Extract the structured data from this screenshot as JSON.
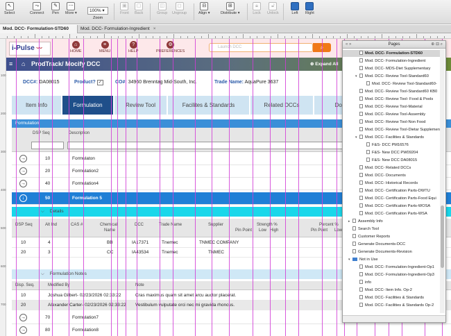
{
  "toolbar": {
    "select": "Select",
    "connect": "Connect",
    "pen": "Pen",
    "more": "More ▾",
    "zoom_value": "100%",
    "zoom_label": "Zoom",
    "front": "Front",
    "back": "Back",
    "group": "Group",
    "ungroup": "Ungroup",
    "align": "Align ▾",
    "distribute": "Distribute ▾",
    "lock": "Lock",
    "unlock": "Unlock",
    "left": "Left",
    "right": "Right"
  },
  "doc_tabs": [
    "Mod. DCC- Formulation-STD60",
    "Mod. DCC- Formulation-Ingredient"
  ],
  "header": {
    "logo": "i-Pulse",
    "nav": [
      "HOME",
      "MENU",
      "HELP",
      "PREFERENCES"
    ],
    "search_placeholder": "Launch DCC",
    "breadcrumb": "ProdTrack/ Mocify DCC",
    "expand_all": "Expand All"
  },
  "info": {
    "dcc_label": "DCC#:",
    "dcc_value": "DA08015",
    "product_label": "Product?",
    "product_mark": "✓",
    "co_label": "CO#:",
    "co_value": "34960 Brenntag Mid-South, Inc.",
    "trade_label": "Trade Name:",
    "trade_value": "AquaPure 3637"
  },
  "form_tabs": [
    "Item Info",
    "Formulation",
    "Review Tool",
    "Facilites & Standards",
    "Related DCCs",
    "Docu"
  ],
  "formulation": {
    "section": "Formulation",
    "col_dsp": "DSP Seq",
    "col_desc": "Description",
    "rows": [
      {
        "seq": "10",
        "desc": "Formulaton"
      },
      {
        "seq": "20",
        "desc": "Formulation2"
      },
      {
        "seq": "40",
        "desc": "Formulation4"
      },
      {
        "seq": "50",
        "desc": "Formulation 5"
      }
    ],
    "details_label": "Details",
    "details_cols": {
      "dsp": "DSP Seq",
      "alt": "Alt Ind",
      "cas": "CAS #",
      "chem_1": "Chemical",
      "chem_2": "Name",
      "dcc": "DCC",
      "trade": "Trade Name",
      "supplier": "Supplier",
      "strength": "Strength %",
      "pp1": "Pin Point",
      "low1": "Low",
      "high1": "High",
      "percent": "Percent %",
      "pp2": "Pin Point",
      "low2": "Low"
    },
    "details_rows": [
      {
        "dsp": "10",
        "alt": "4",
        "chem": "BB",
        "dcc": "IA17371",
        "trade": "Tnemec",
        "supplier": "TNMEC COMPANY"
      },
      {
        "dsp": "20",
        "alt": "3",
        "chem": "CC",
        "dcc": "IA43534",
        "trade": "Tnemec",
        "supplier": "TNMEC"
      }
    ],
    "notes_label": "Formulation Notes",
    "notes_cols": {
      "seq": "Disp. Seq.",
      "by": "Modified By",
      "note": "Note"
    },
    "notes_rows": [
      {
        "seq": "10",
        "by": "Joshua Gilbert- 02/23/2026  02:33:22",
        "note": "Cras maximus quam sit amet arcu auctor placerat."
      },
      {
        "seq": "20",
        "by": "Alexander Carter- 02/23/2026  02:33:22",
        "note": "Vestibulum vulputate orci nec mi gravida rhoncus."
      }
    ],
    "tail_rows": [
      {
        "seq": "70",
        "desc": "Formulation7"
      },
      {
        "seq": "80",
        "desc": "Formulation8"
      }
    ]
  },
  "ruler_v": [
    "100",
    "200",
    "300",
    "400",
    "500",
    "600",
    "700"
  ],
  "pages_panel": {
    "title": "Pages",
    "left_ctl": "«  »",
    "right_ctl": "⊕ ⊟ ⌕",
    "items": [
      {
        "t": "Mod. DCC- Formulation-STD60",
        "lvl": 1,
        "sel": true
      },
      {
        "t": "Mod. DCC- Formulation-Ingredient",
        "lvl": 1
      },
      {
        "t": "Mod. DCC- MDS-Diet Supplementary",
        "lvl": 1
      },
      {
        "t": "Mod. DCC- Review Tool-Standard60",
        "lvl": 1,
        "fold": "▾"
      },
      {
        "t": "Mod. DCC- Review Tool-Standard60-",
        "lvl": 2
      },
      {
        "t": "Mod. DCC- Review Tool-Standard60 KB0",
        "lvl": 1
      },
      {
        "t": "Mod. DCC- Review Tool- Food & Pools",
        "lvl": 1
      },
      {
        "t": "Mod. DCC- Review Tool-Material",
        "lvl": 1
      },
      {
        "t": "Mod. DCC- Review Tool-Assembly",
        "lvl": 1
      },
      {
        "t": "Mod. DCC- Review Tool-Non Food",
        "lvl": 1
      },
      {
        "t": "Mod. DCC- Review Tool-Dietar Supplement",
        "lvl": 1
      },
      {
        "t": "Mod. DCC- Facilities & Standards",
        "lvl": 1,
        "fold": "▾"
      },
      {
        "t": "F&S- DCC PM16576",
        "lvl": 2
      },
      {
        "t": "F&S- New DCC PW09204",
        "lvl": 2
      },
      {
        "t": "F&S- New DCC DA08015",
        "lvl": 2
      },
      {
        "t": "Mod. DCC- Related DCCs",
        "lvl": 1
      },
      {
        "t": "Mod. DCC- Documents",
        "lvl": 1
      },
      {
        "t": "Mod. DCC- Historical Records",
        "lvl": 1
      },
      {
        "t": "Mod. DCC- Certification Parts-DWTU",
        "lvl": 1
      },
      {
        "t": "Mod. DCC- Certification Parts-Food Equi",
        "lvl": 1
      },
      {
        "t": "Mod. DCC- Certification Parts-WOSA",
        "lvl": 1
      },
      {
        "t": "Mod. DCC- Certification Parts-WSA",
        "lvl": 1
      },
      {
        "t": "Assembly Info",
        "lvl": 0,
        "fold": "▸"
      },
      {
        "t": "Search Tool",
        "lvl": 0
      },
      {
        "t": "Customer Reports",
        "lvl": 0
      },
      {
        "t": "Generate Documents-DCC",
        "lvl": 0
      },
      {
        "t": "Generate Documents-Revision",
        "lvl": 0
      },
      {
        "t": "Not in Use",
        "lvl": 0,
        "fold": "▾",
        "folder": true
      },
      {
        "t": "Mod. DCC- Formulation-Ingredient-Op1",
        "lvl": 1
      },
      {
        "t": "Mod. DCC- Formulation-Ingredient-Op3",
        "lvl": 1
      },
      {
        "t": "info",
        "lvl": 1
      },
      {
        "t": "Mod. DCC- Item Info. Op-2",
        "lvl": 1
      },
      {
        "t": "Mod. DCC- Facilities & Standards",
        "lvl": 1
      },
      {
        "t": "Mod. DCC- Facilities & Standards Op-2",
        "lvl": 1
      }
    ]
  },
  "colors": {
    "accent": "#1f4f8a",
    "selection": "#1f7fd6",
    "guide": "#d13cd6",
    "cyan": "#19d7ea"
  }
}
